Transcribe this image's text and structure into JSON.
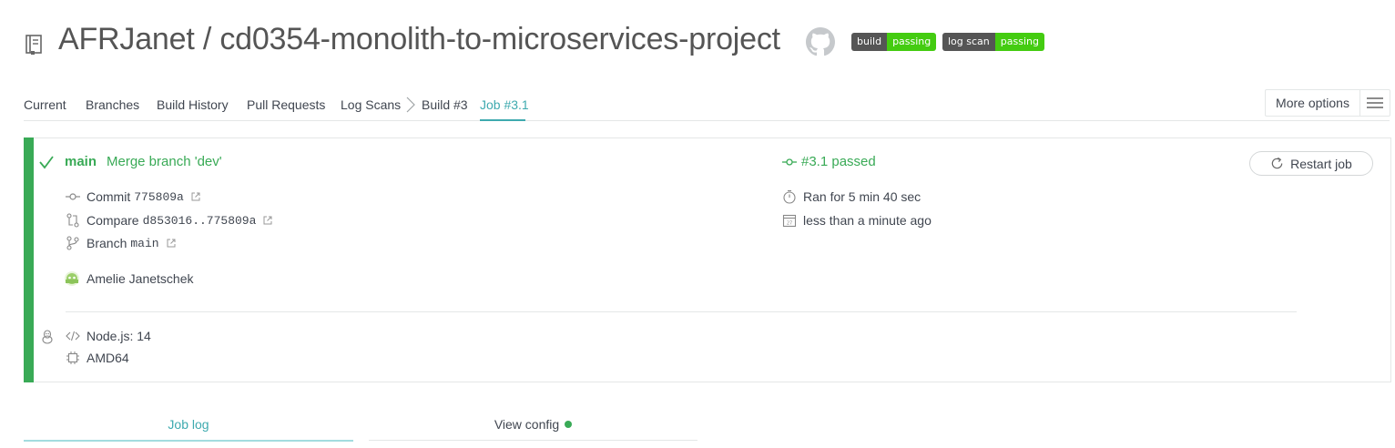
{
  "header": {
    "owner": "AFRJanet",
    "separator": "/",
    "repo": "cd0354-monolith-to-microservices-project",
    "badges": [
      {
        "left": "build",
        "right": "passing"
      },
      {
        "left": "log scan",
        "right": "passing"
      }
    ]
  },
  "tabs": {
    "items": [
      "Current",
      "Branches",
      "Build History",
      "Pull Requests",
      "Log Scans"
    ],
    "build": "Build #3",
    "job": "Job #3.1",
    "more_options": "More options"
  },
  "job": {
    "branch": "main",
    "message": "Merge branch 'dev'",
    "commit_label": "Commit",
    "commit_sha": "775809a",
    "compare_label": "Compare",
    "compare_range": "d853016..775809a",
    "branch_label": "Branch",
    "branch_value": "main",
    "author": "Amelie Janetschek",
    "status": "#3.1 passed",
    "duration": "Ran for 5 min 40 sec",
    "finished": "less than a minute ago",
    "restart": "Restart job",
    "language": "Node.js: 14",
    "arch": "AMD64",
    "colors": {
      "passed": "#39aa56",
      "accent": "#3eaaaf"
    }
  },
  "bottom_tabs": {
    "job_log": "Job log",
    "view_config": "View config"
  }
}
